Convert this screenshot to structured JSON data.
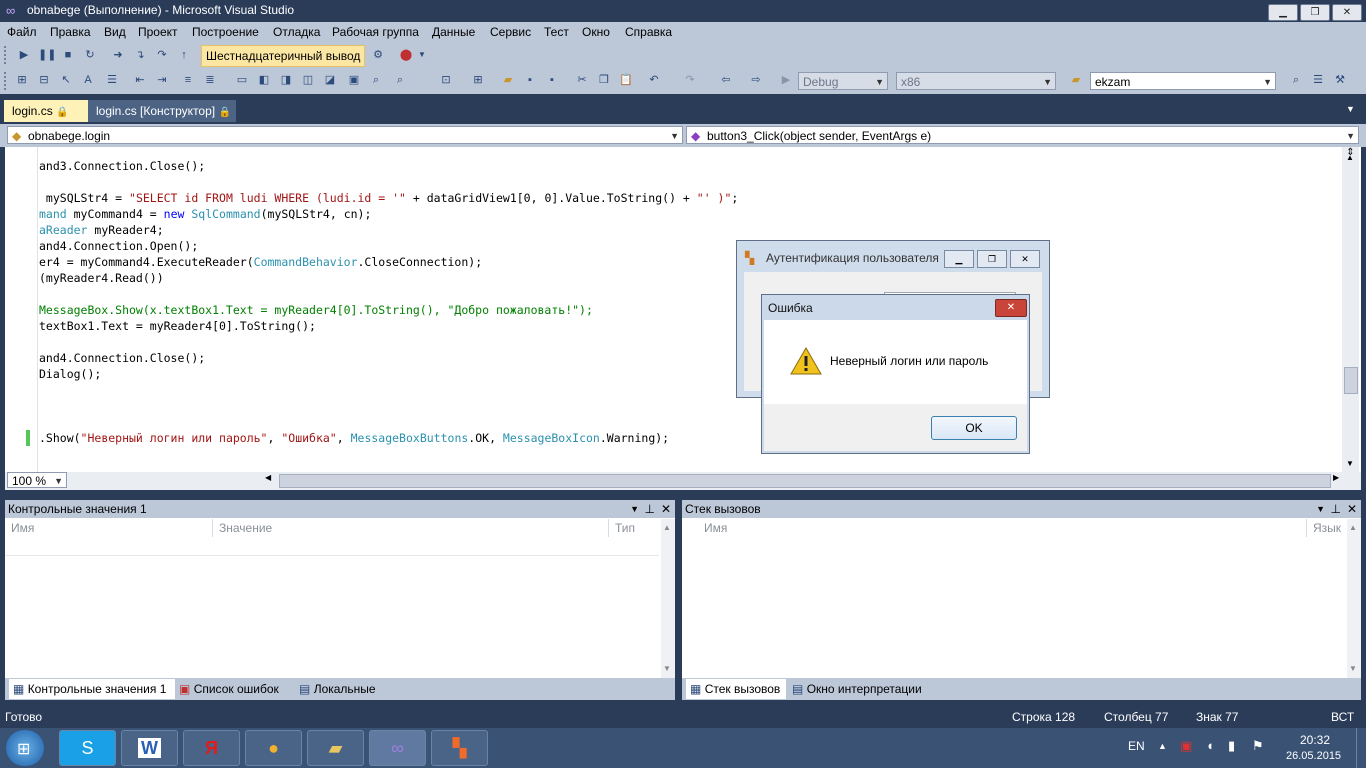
{
  "window": {
    "title": "obnabege (Выполнение) - Microsoft Visual Studio",
    "min_glyph": "▁",
    "max_glyph": "❐",
    "close_glyph": "✕"
  },
  "menu": [
    "Файл",
    "Правка",
    "Вид",
    "Проект",
    "Построение",
    "Отладка",
    "Рабочая группа",
    "Данные",
    "Сервис",
    "Тест",
    "Окно",
    "Справка"
  ],
  "toolbar": {
    "hex_label": "Шестнадцатеричный вывод",
    "config": "Debug",
    "platform": "x86",
    "find": "ekzam"
  },
  "tabs": [
    {
      "label": "login.cs",
      "active": true
    },
    {
      "label": "login.cs [Конструктор]",
      "active": false
    }
  ],
  "nav": {
    "class_combo": "obnabege.login",
    "member_combo": "button3_Click(object sender, EventArgs e)"
  },
  "editor": {
    "zoom": "100 %",
    "lines": [
      {
        "tokens": [
          {
            "t": "and3.Connection.Close();"
          }
        ]
      },
      {
        "tokens": []
      },
      {
        "tokens": [
          {
            "t": " mySQLStr4 = "
          },
          {
            "t": "\"SELECT id FROM ludi WHERE (ludi.id = '\"",
            "c": "st"
          },
          {
            "t": " + dataGridView1[0, 0].Value.ToString() + "
          },
          {
            "t": "\"' )\"",
            "c": "st"
          },
          {
            "t": ";"
          }
        ]
      },
      {
        "tokens": [
          {
            "t": "mand",
            "c": "ty"
          },
          {
            "t": " myCommand4 = "
          },
          {
            "t": "new",
            "c": "kw"
          },
          {
            "t": " "
          },
          {
            "t": "SqlCommand",
            "c": "ty"
          },
          {
            "t": "(mySQLStr4, cn);"
          }
        ]
      },
      {
        "tokens": [
          {
            "t": "aReader",
            "c": "ty"
          },
          {
            "t": " myReader4;"
          }
        ]
      },
      {
        "tokens": [
          {
            "t": "and4.Connection.Open();"
          }
        ]
      },
      {
        "tokens": [
          {
            "t": "er4 = myCommand4.ExecuteReader("
          },
          {
            "t": "CommandBehavior",
            "c": "ty"
          },
          {
            "t": ".CloseConnection);"
          }
        ]
      },
      {
        "tokens": [
          {
            "t": "(myReader4.Read())"
          }
        ]
      },
      {
        "tokens": []
      },
      {
        "tokens": [
          {
            "t": "MessageBox.Show(x.textBox1.Text = myReader4[0].ToString(), \"Добро пожаловать!\");",
            "c": "cm"
          }
        ]
      },
      {
        "tokens": [
          {
            "t": "textBox1.Text = myReader4[0].ToString();"
          }
        ]
      },
      {
        "tokens": []
      },
      {
        "tokens": [
          {
            "t": "and4.Connection.Close();"
          }
        ]
      },
      {
        "tokens": [
          {
            "t": "Dialog();"
          }
        ]
      },
      {
        "tokens": []
      },
      {
        "tokens": []
      },
      {
        "tokens": []
      },
      {
        "tokens": [
          {
            "t": ".Show("
          },
          {
            "t": "\"Неверный логин или пароль\"",
            "c": "st"
          },
          {
            "t": ", "
          },
          {
            "t": "\"Ошибка\"",
            "c": "st"
          },
          {
            "t": ", "
          },
          {
            "t": "MessageBoxButtons",
            "c": "ty"
          },
          {
            "t": ".OK, "
          },
          {
            "t": "MessageBoxIcon",
            "c": "ty"
          },
          {
            "t": ".Warning);"
          }
        ]
      }
    ]
  },
  "watch_panel": {
    "title": "Контрольные значения 1",
    "columns": [
      "Имя",
      "Значение",
      "Тип"
    ]
  },
  "callstack_panel": {
    "title": "Стек вызовов",
    "columns": [
      "Имя",
      "Язык"
    ]
  },
  "bottom_tabs_left": [
    "Контрольные значения 1",
    "Список ошибок",
    "Локальные"
  ],
  "bottom_tabs_right": [
    "Стек вызовов",
    "Окно интерпретации"
  ],
  "status": {
    "ready": "Готово",
    "line": "Строка 128",
    "col": "Столбец 77",
    "char": "Знак 77",
    "mode": "ВСТ"
  },
  "auth_dialog": {
    "title": "Аутентификация пользователя"
  },
  "error_dialog": {
    "title": "Ошибка",
    "message": "Неверный логин или пароль",
    "ok": "OK"
  },
  "taskbar": {
    "lang": "EN",
    "time": "20:32",
    "date": "26.05.2015"
  },
  "colors": {
    "chrome": "#2b3c59",
    "toolbar": "#bcc7d8",
    "string": "#a31515",
    "keyword": "#0000ff",
    "type": "#2b91af",
    "comment": "#008000"
  }
}
